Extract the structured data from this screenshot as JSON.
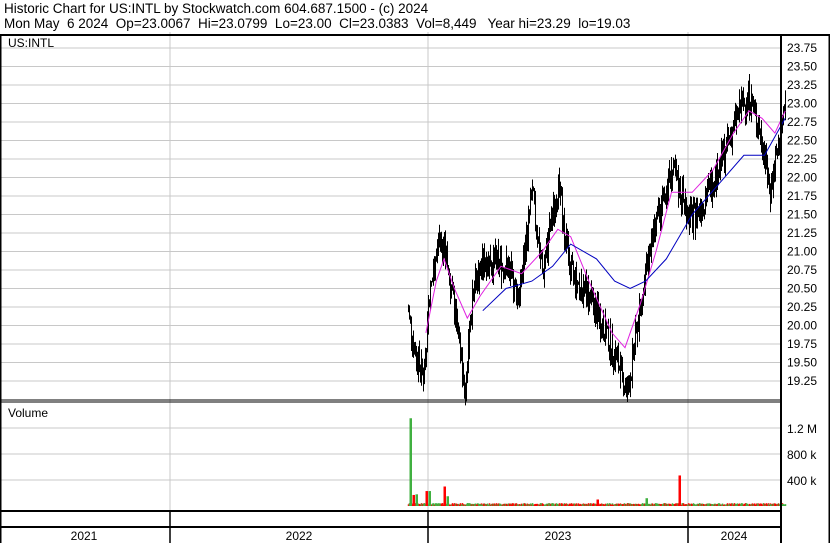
{
  "header": {
    "title": "Historic Chart for US:INTL by Stockwatch.com 604.687.1500 - (c) 2024",
    "quote": "Mon May  6 2024  Op=23.0067  Hi=23.0799  Lo=23.00  Cl=23.0383  Vol=8,449   Year hi=23.29  lo=19.03"
  },
  "chart_data": {
    "type": "line",
    "title": "US:INTL",
    "volume_label": "Volume",
    "price_ylim": [
      19.0,
      23.85
    ],
    "price_ticks": [
      "23.75",
      "23.50",
      "23.25",
      "23.00",
      "22.75",
      "22.50",
      "22.25",
      "22.00",
      "21.75",
      "21.50",
      "21.25",
      "21.00",
      "20.75",
      "20.50",
      "20.25",
      "20.00",
      "19.75",
      "19.50",
      "19.25"
    ],
    "volume_ticks": [
      {
        "label": "1.2 M",
        "value": 1200000
      },
      {
        "label": "800 k",
        "value": 800000
      },
      {
        "label": "400 k",
        "value": 400000
      }
    ],
    "years": [
      "2021",
      "2022",
      "2023",
      "2024"
    ],
    "x_unit": "years since 2021-01-01",
    "price_keypoints": [
      [
        1.92,
        20.2
      ],
      [
        1.95,
        19.6
      ],
      [
        1.98,
        19.3
      ],
      [
        2.0,
        20.3
      ],
      [
        2.04,
        21.2
      ],
      [
        2.07,
        20.9
      ],
      [
        2.1,
        20.2
      ],
      [
        2.14,
        19.1
      ],
      [
        2.17,
        20.5
      ],
      [
        2.22,
        20.9
      ],
      [
        2.3,
        20.8
      ],
      [
        2.35,
        20.4
      ],
      [
        2.4,
        21.8
      ],
      [
        2.44,
        20.7
      ],
      [
        2.5,
        21.9
      ],
      [
        2.55,
        20.7
      ],
      [
        2.62,
        20.4
      ],
      [
        2.69,
        19.9
      ],
      [
        2.77,
        19.1
      ],
      [
        2.82,
        20.3
      ],
      [
        2.86,
        21.1
      ],
      [
        2.94,
        22.1
      ],
      [
        3.02,
        21.4
      ],
      [
        3.08,
        21.8
      ],
      [
        3.14,
        22.3
      ],
      [
        3.2,
        22.9
      ],
      [
        3.24,
        23.1
      ],
      [
        3.29,
        22.5
      ],
      [
        3.32,
        21.8
      ],
      [
        3.36,
        22.6
      ],
      [
        3.38,
        23.0
      ]
    ],
    "ma_short_keypoints": [
      [
        1.99,
        19.9
      ],
      [
        2.03,
        20.6
      ],
      [
        2.06,
        20.9
      ],
      [
        2.1,
        20.5
      ],
      [
        2.15,
        20.1
      ],
      [
        2.2,
        20.4
      ],
      [
        2.28,
        20.8
      ],
      [
        2.36,
        20.7
      ],
      [
        2.44,
        21.0
      ],
      [
        2.5,
        21.3
      ],
      [
        2.55,
        21.2
      ],
      [
        2.62,
        20.6
      ],
      [
        2.71,
        19.9
      ],
      [
        2.76,
        19.7
      ],
      [
        2.82,
        20.3
      ],
      [
        2.88,
        21.0
      ],
      [
        2.94,
        21.8
      ],
      [
        3.02,
        21.8
      ],
      [
        3.1,
        22.1
      ],
      [
        3.18,
        22.6
      ],
      [
        3.24,
        22.9
      ],
      [
        3.29,
        22.8
      ],
      [
        3.34,
        22.6
      ],
      [
        3.38,
        22.9
      ]
    ],
    "ma_long_keypoints": [
      [
        2.21,
        20.2
      ],
      [
        2.3,
        20.5
      ],
      [
        2.4,
        20.6
      ],
      [
        2.48,
        20.8
      ],
      [
        2.55,
        21.1
      ],
      [
        2.65,
        20.9
      ],
      [
        2.72,
        20.6
      ],
      [
        2.78,
        20.5
      ],
      [
        2.84,
        20.6
      ],
      [
        2.92,
        20.9
      ],
      [
        3.02,
        21.5
      ],
      [
        3.12,
        21.9
      ],
      [
        3.22,
        22.3
      ],
      [
        3.3,
        22.3
      ],
      [
        3.38,
        22.8
      ]
    ],
    "volume_spikes": [
      [
        1.93,
        1350000
      ],
      [
        1.94,
        170000
      ],
      [
        1.95,
        180000
      ],
      [
        1.99,
        230000
      ],
      [
        2.0,
        230000
      ],
      [
        2.06,
        300000
      ],
      [
        2.07,
        150000
      ],
      [
        2.97,
        470000
      ],
      [
        2.84,
        120000
      ],
      [
        2.65,
        100000
      ]
    ],
    "colors": {
      "price": "#000000",
      "ma_short": "#e020e0",
      "ma_long": "#0000c0",
      "vol_up": "#40b040",
      "vol_down": "#ff0000",
      "grid": "#c8c8c8"
    }
  }
}
